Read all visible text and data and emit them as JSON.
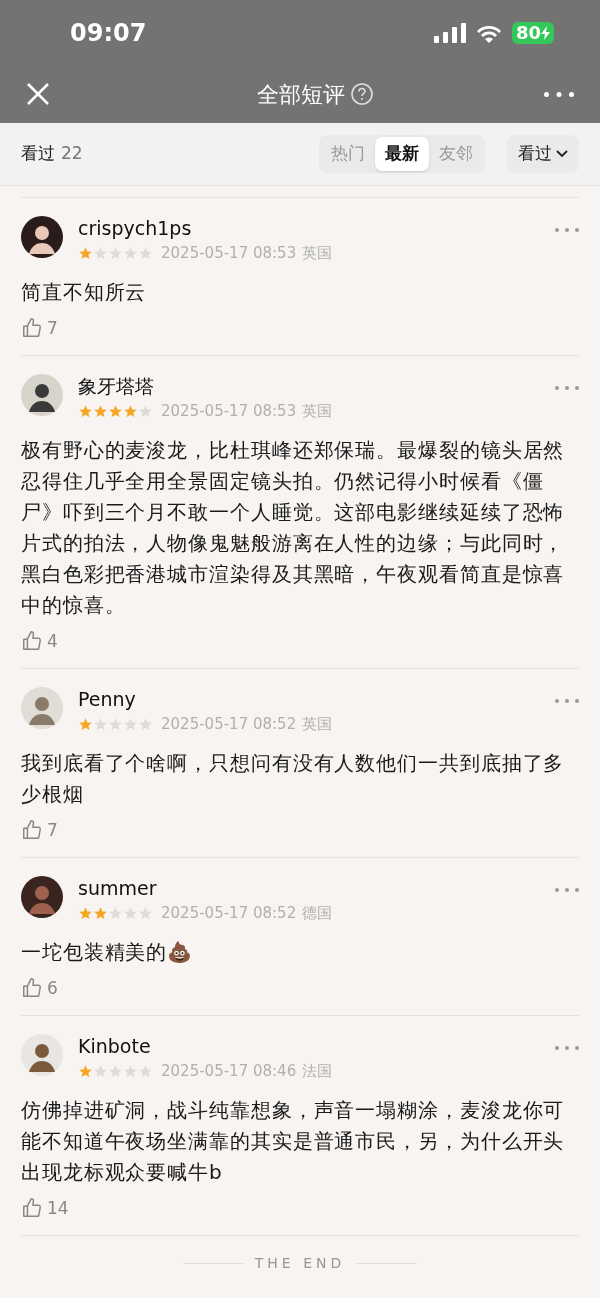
{
  "status_bar": {
    "time": "09:07",
    "battery": "80"
  },
  "nav": {
    "title": "全部短评"
  },
  "filter_bar": {
    "label": "看过",
    "count": "22",
    "tabs": [
      {
        "label": "热门",
        "selected": false
      },
      {
        "label": "最新",
        "selected": true
      },
      {
        "label": "友邻",
        "selected": false
      }
    ],
    "dropdown": "看过"
  },
  "reviews": [
    {
      "user": "crispych1ps",
      "stars": 1,
      "date": "2025-05-17 08:53",
      "region": "英国",
      "text": "简直不知所云",
      "likes": "7"
    },
    {
      "user": "象牙塔塔",
      "stars": 4,
      "date": "2025-05-17 08:53",
      "region": "英国",
      "text": "极有野心的麦浚龙，比杜琪峰还郑保瑞。最爆裂的镜头居然忍得住几乎全用全景固定镜头拍。仍然记得小时候看《僵尸》吓到三个月不敢一个人睡觉。这部电影继续延续了恐怖片式的拍法，人物像鬼魅般游离在人性的边缘；与此同时，黑白色彩把香港城市渲染得及其黑暗，午夜观看简直是惊喜中的惊喜。",
      "likes": "4"
    },
    {
      "user": "Penny",
      "stars": 1,
      "date": "2025-05-17 08:52",
      "region": "英国",
      "text": "我到底看了个啥啊，只想问有没有人数他们一共到底抽了多少根烟",
      "likes": "7"
    },
    {
      "user": "summer",
      "stars": 2,
      "date": "2025-05-17 08:52",
      "region": "德国",
      "text": "一坨包装精美的💩",
      "likes": "6"
    },
    {
      "user": "Kinbote",
      "stars": 1,
      "date": "2025-05-17 08:46",
      "region": "法国",
      "text": "仿佛掉进矿洞，战斗纯靠想象，声音一塌糊涂，麦浚龙你可能不知道午夜场坐满靠的其实是普通市民，另，为什么开头出现龙标观众要喊牛b",
      "likes": "14"
    }
  ],
  "footer": {
    "text": "THE END"
  }
}
